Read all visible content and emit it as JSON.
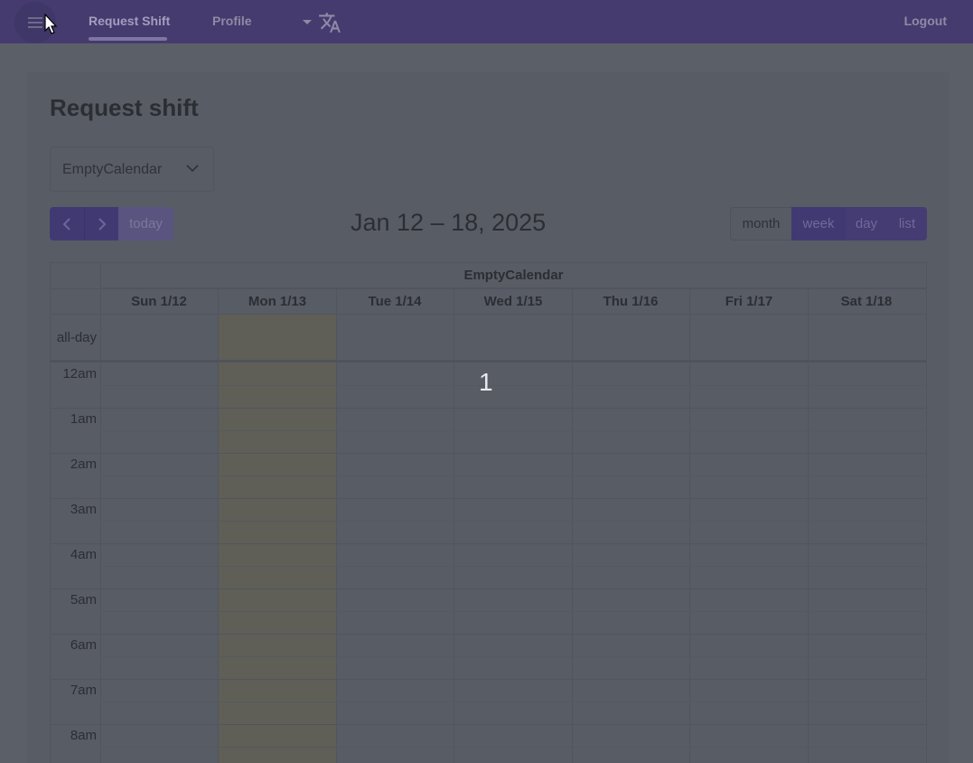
{
  "nav": {
    "tabs": [
      {
        "label": "Request Shift"
      },
      {
        "label": "Profile"
      }
    ],
    "logout_label": "Logout"
  },
  "page": {
    "title": "Request shift"
  },
  "calendar_select": {
    "value": "EmptyCalendar"
  },
  "toolbar": {
    "today_label": "today",
    "range_title": "Jan 12 – 18, 2025",
    "views": [
      "month",
      "week",
      "day",
      "list"
    ],
    "active_view": "week"
  },
  "calendar": {
    "resource": "EmptyCalendar",
    "days": [
      "Sun 1/12",
      "Mon 1/13",
      "Tue 1/14",
      "Wed 1/15",
      "Thu 1/16",
      "Fri 1/17",
      "Sat 1/18"
    ],
    "allday_label": "all-day",
    "time_slots": [
      "12am",
      "1am",
      "2am",
      "3am",
      "4am",
      "5am",
      "6am",
      "7am",
      "8am"
    ],
    "highlighted_day": "Mon 1/13"
  },
  "overlay_marker": "1",
  "colors": {
    "topbar": "#453b6e",
    "primary_button": "#413a72",
    "background": "#5b6068"
  }
}
